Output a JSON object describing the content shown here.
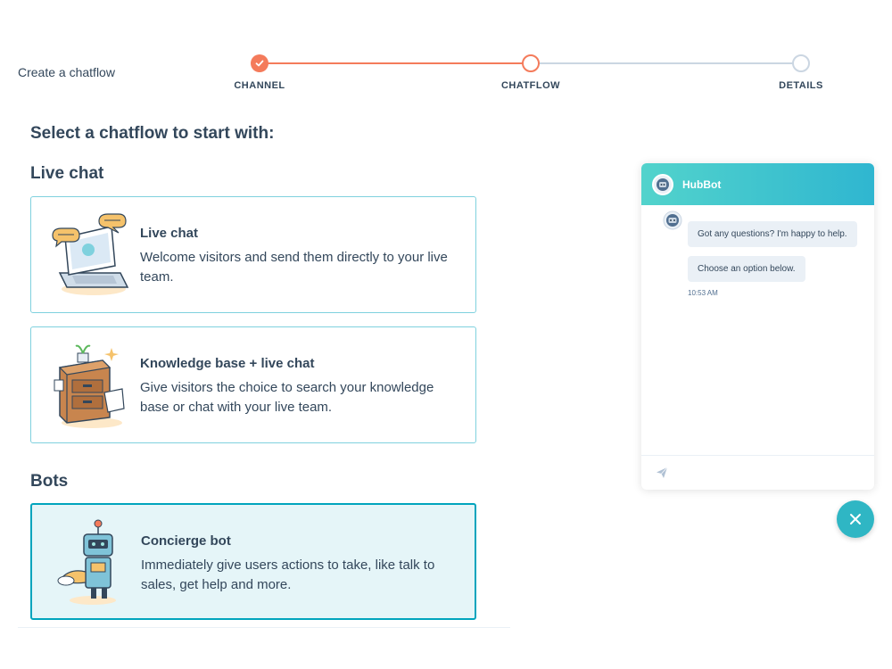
{
  "wizard": {
    "title": "Create a chatflow",
    "steps": [
      {
        "label": "CHANNEL",
        "state": "complete"
      },
      {
        "label": "CHATFLOW",
        "state": "active"
      },
      {
        "label": "DETAILS",
        "state": "pending"
      }
    ]
  },
  "main": {
    "heading": "Select a chatflow to start with:",
    "sections": [
      {
        "heading": "Live chat",
        "options": [
          {
            "title": "Live chat",
            "description": "Welcome visitors and send them directly to your live team.",
            "icon": "laptop-chat-illustration",
            "selected": false
          },
          {
            "title": "Knowledge base + live chat",
            "description": "Give visitors the choice to search your knowledge base or chat with your live team.",
            "icon": "filing-cabinet-illustration",
            "selected": false
          }
        ]
      },
      {
        "heading": "Bots",
        "options": [
          {
            "title": "Concierge bot",
            "description": "Immediately give users actions to take, like talk to sales, get help and more.",
            "icon": "robot-illustration",
            "selected": true
          }
        ]
      }
    ]
  },
  "chat_preview": {
    "bot_name": "HubBot",
    "messages": [
      "Got any questions? I'm happy to help.",
      "Choose an option below."
    ],
    "timestamp": "10:53 AM",
    "send_icon": "paper-plane-icon",
    "close_icon": "close-icon"
  },
  "colors": {
    "accent_orange": "#f47b5b",
    "accent_teal": "#00a4bd",
    "text": "#33475b",
    "card_border": "#7fd1de",
    "selected_bg": "#e5f5f8"
  }
}
